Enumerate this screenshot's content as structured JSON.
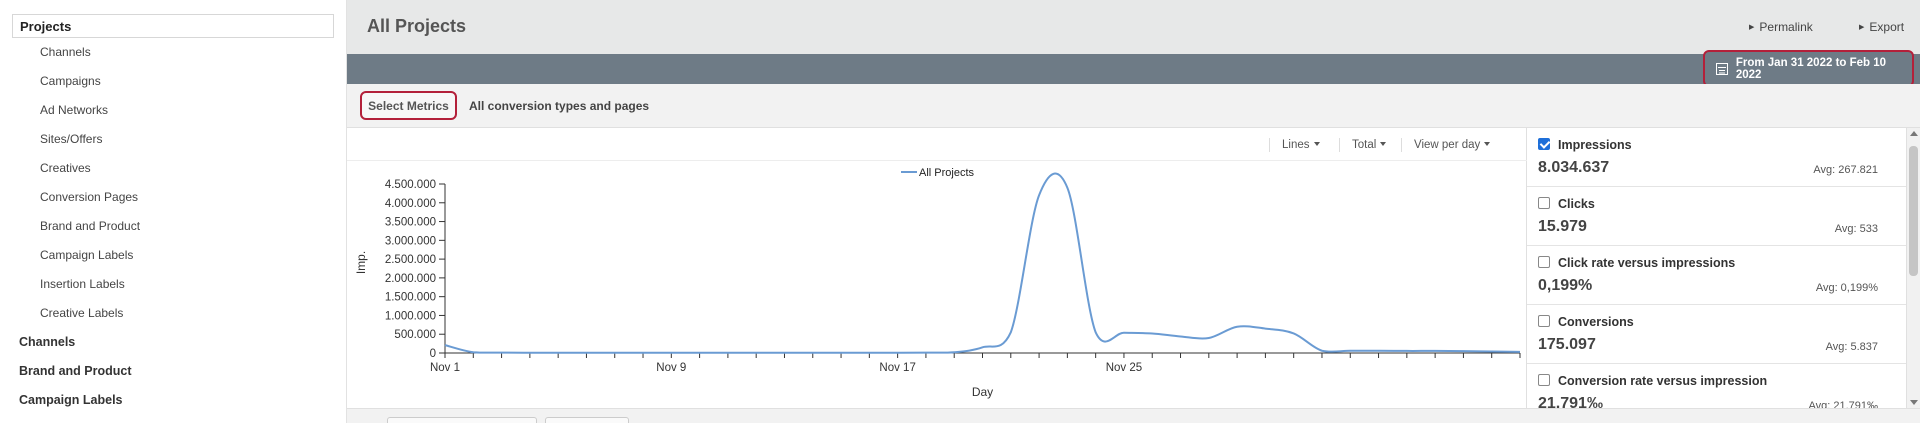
{
  "sidebar": {
    "active": "Projects",
    "sub_items": [
      "Channels",
      "Campaigns",
      "Ad Networks",
      "Sites/Offers",
      "Creatives",
      "Conversion Pages",
      "Brand and Product",
      "Campaign Labels",
      "Insertion Labels",
      "Creative Labels"
    ],
    "top_items": [
      "Channels",
      "Brand and Product",
      "Campaign Labels"
    ]
  },
  "header": {
    "title": "All Projects",
    "permalink": "Permalink",
    "export": "Export"
  },
  "datebar": {
    "range": "From Jan 31 2022 to Feb 10 2022"
  },
  "metricsbar": {
    "select_metrics": "Select Metrics",
    "conversion_filter": "All conversion types and pages"
  },
  "chart_tools": {
    "lines": "Lines",
    "total": "Total",
    "view": "View per day"
  },
  "chart_data": {
    "type": "line",
    "title": "",
    "xlabel": "Day",
    "ylabel": "Imp.",
    "ylim": [
      0,
      4500000
    ],
    "y_ticks": [
      "0",
      "500.000",
      "1.000.000",
      "1.500.000",
      "2.000.000",
      "2.500.000",
      "3.000.000",
      "3.500.000",
      "4.000.000",
      "4.500.000"
    ],
    "x_ticks": [
      "Nov 1",
      "Nov 9",
      "Nov 17",
      "Nov 25"
    ],
    "legend": "top-center",
    "color": "#6a9bd3",
    "series": [
      {
        "name": "All Projects",
        "points": [
          [
            1,
            210000
          ],
          [
            2,
            20000
          ],
          [
            3,
            10000
          ],
          [
            4,
            8000
          ],
          [
            5,
            8000
          ],
          [
            6,
            8000
          ],
          [
            7,
            8000
          ],
          [
            8,
            8000
          ],
          [
            9,
            8000
          ],
          [
            10,
            8000
          ],
          [
            11,
            8000
          ],
          [
            12,
            8000
          ],
          [
            13,
            8000
          ],
          [
            14,
            8000
          ],
          [
            15,
            8000
          ],
          [
            16,
            8000
          ],
          [
            17,
            8000
          ],
          [
            18,
            10000
          ],
          [
            19,
            20000
          ],
          [
            20,
            150000
          ],
          [
            21,
            550000
          ],
          [
            22,
            4200000
          ],
          [
            23,
            4400000
          ],
          [
            24,
            550000
          ],
          [
            25,
            540000
          ],
          [
            26,
            520000
          ],
          [
            27,
            440000
          ],
          [
            28,
            400000
          ],
          [
            29,
            700000
          ],
          [
            30,
            650000
          ],
          [
            31,
            520000
          ],
          [
            32,
            60000
          ],
          [
            33,
            60000
          ],
          [
            34,
            60000
          ],
          [
            35,
            55000
          ],
          [
            36,
            55000
          ],
          [
            37,
            50000
          ],
          [
            38,
            40000
          ],
          [
            39,
            30000
          ]
        ]
      }
    ]
  },
  "metrics": [
    {
      "name": "Impressions",
      "value": "8.034.637",
      "avg": "Avg: 267.821",
      "checked": true
    },
    {
      "name": "Clicks",
      "value": "15.979",
      "avg": "Avg: 533",
      "checked": false
    },
    {
      "name": "Click rate versus impressions",
      "value": "0,199%",
      "avg": "Avg: 0,199%",
      "checked": false
    },
    {
      "name": "Conversions",
      "value": "175.097",
      "avg": "Avg: 5.837",
      "checked": false
    },
    {
      "name": "Conversion rate versus impression",
      "value": "21,791‰",
      "avg": "Avg: 21,791‰",
      "checked": false
    }
  ]
}
